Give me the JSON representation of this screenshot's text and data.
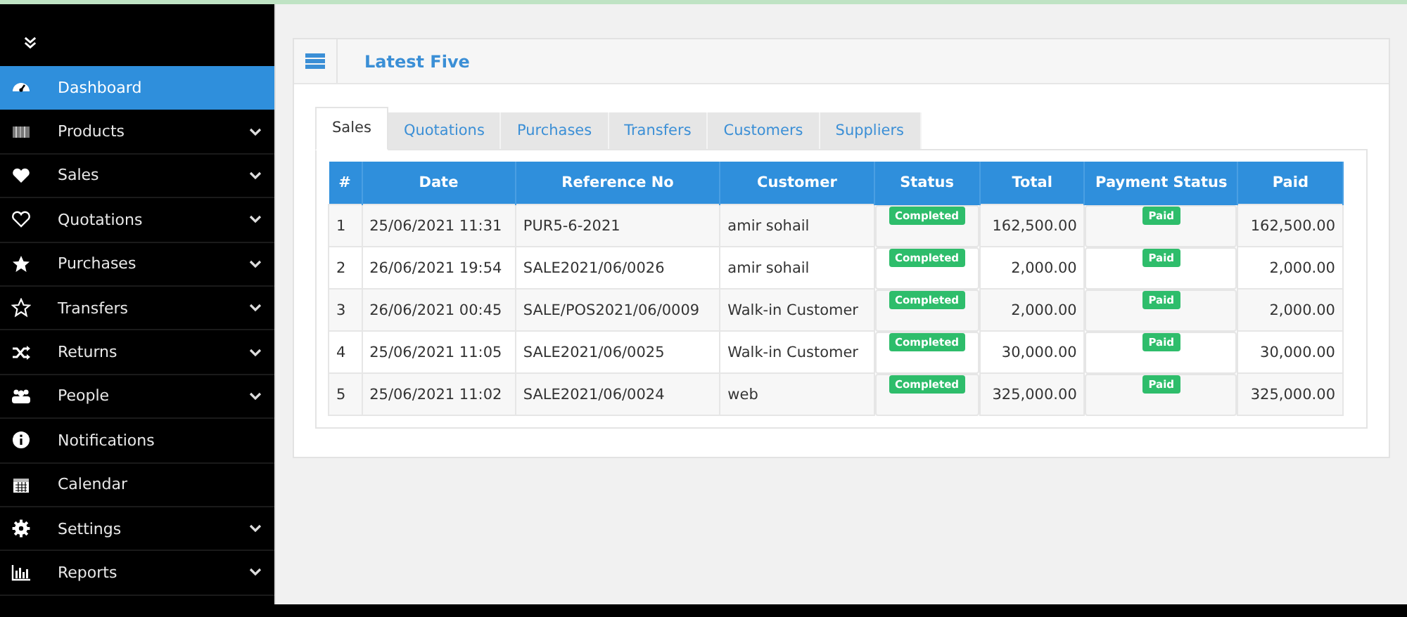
{
  "sidebar": {
    "items": [
      {
        "label": "Dashboard",
        "selected": true,
        "submenu": false
      },
      {
        "label": "Products",
        "selected": false,
        "submenu": true
      },
      {
        "label": "Sales",
        "selected": false,
        "submenu": true
      },
      {
        "label": "Quotations",
        "selected": false,
        "submenu": true
      },
      {
        "label": "Purchases",
        "selected": false,
        "submenu": true
      },
      {
        "label": "Transfers",
        "selected": false,
        "submenu": true
      },
      {
        "label": "Returns",
        "selected": false,
        "submenu": true
      },
      {
        "label": "People",
        "selected": false,
        "submenu": true
      },
      {
        "label": "Notifications",
        "selected": false,
        "submenu": false
      },
      {
        "label": "Calendar",
        "selected": false,
        "submenu": false
      },
      {
        "label": "Settings",
        "selected": false,
        "submenu": true
      },
      {
        "label": "Reports",
        "selected": false,
        "submenu": true
      }
    ]
  },
  "panel": {
    "title": "Latest Five",
    "tabs": [
      {
        "label": "Sales",
        "selected": true
      },
      {
        "label": "Quotations",
        "selected": false
      },
      {
        "label": "Purchases",
        "selected": false
      },
      {
        "label": "Transfers",
        "selected": false
      },
      {
        "label": "Customers",
        "selected": false
      },
      {
        "label": "Suppliers",
        "selected": false
      }
    ],
    "table": {
      "columns": [
        "#",
        "Date",
        "Reference No",
        "Customer",
        "Status",
        "Total",
        "Payment Status",
        "Paid"
      ],
      "rows": [
        {
          "number": "1",
          "date": "25/06/2021 11:31",
          "reference": "PUR5-6-2021",
          "customer": "amir sohail",
          "status": "Completed",
          "total": "162,500.00",
          "payment_status": "Paid",
          "paid": "162,500.00"
        },
        {
          "number": "2",
          "date": "26/06/2021 19:54",
          "reference": "SALE2021/06/0026",
          "customer": "amir sohail",
          "status": "Completed",
          "total": "2,000.00",
          "payment_status": "Paid",
          "paid": "2,000.00"
        },
        {
          "number": "3",
          "date": "26/06/2021 00:45",
          "reference": "SALE/POS2021/06/0009",
          "customer": "Walk-in Customer",
          "status": "Completed",
          "total": "2,000.00",
          "payment_status": "Paid",
          "paid": "2,000.00"
        },
        {
          "number": "4",
          "date": "25/06/2021 11:05",
          "reference": "SALE2021/06/0025",
          "customer": "Walk-in Customer",
          "status": "Completed",
          "total": "30,000.00",
          "payment_status": "Paid",
          "paid": "30,000.00"
        },
        {
          "number": "5",
          "date": "25/06/2021 11:02",
          "reference": "SALE2021/06/0024",
          "customer": "web",
          "status": "Completed",
          "total": "325,000.00",
          "payment_status": "Paid",
          "paid": "325,000.00"
        }
      ]
    }
  }
}
